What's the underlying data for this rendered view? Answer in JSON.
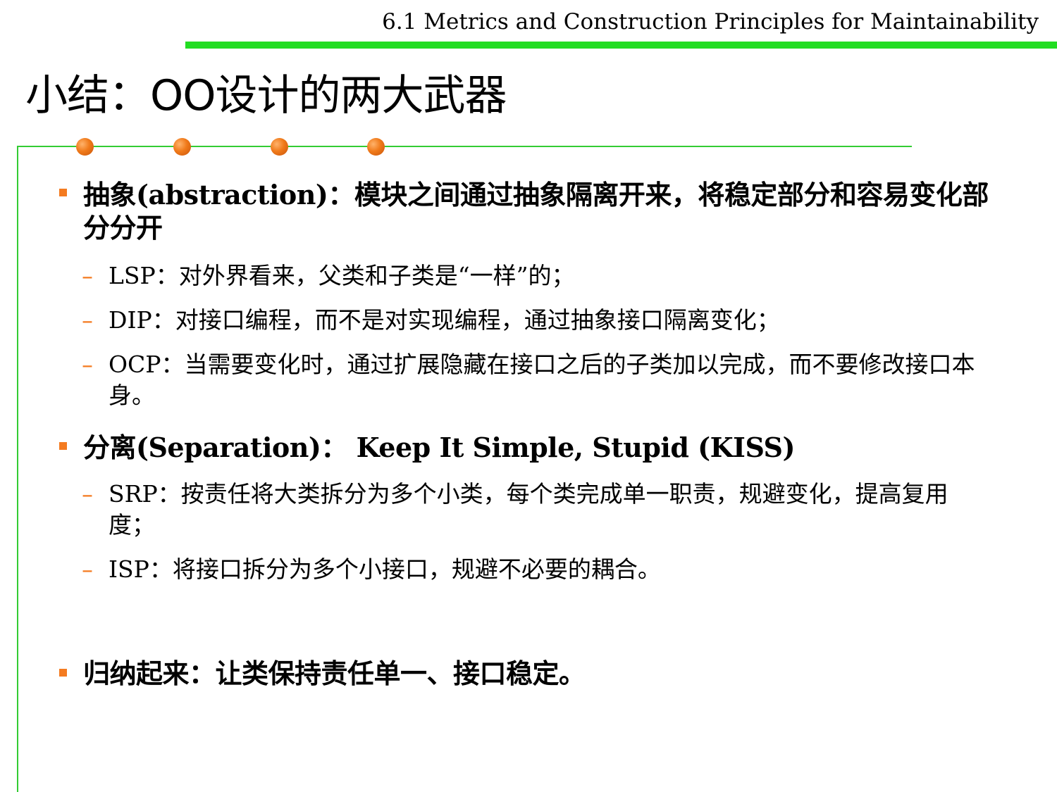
{
  "header": {
    "title": "6.1 Metrics and Construction Principles for Maintainability"
  },
  "slide": {
    "title": "小结：OO设计的两大武器"
  },
  "colors": {
    "header_rule": "#22dd22",
    "frame": "#33cc33",
    "bullet": "#f47b20",
    "dash": "#f47b20"
  },
  "points": [
    {
      "text": "抽象(abstraction)：模块之间通过抽象隔离开来，将稳定部分和容易变化部分分开",
      "subpoints": [
        "LSP：对外界看来，父类和子类是“一样”的；",
        "DIP：对接口编程，而不是对实现编程，通过抽象接口隔离变化；",
        "OCP：当需要变化时，通过扩展隐藏在接口之后的子类加以完成，而不要修改接口本身。"
      ]
    },
    {
      "text": "分离(Separation)： Keep It Simple, Stupid (KISS)",
      "subpoints": [
        "SRP：按责任将大类拆分为多个小类，每个类完成单一职责，规避变化，提高复用度；",
        "ISP：将接口拆分为多个小接口，规避不必要的耦合。"
      ]
    },
    {
      "text": "归纳起来：让类保持责任单一、接口稳定。",
      "subpoints": []
    }
  ],
  "dash_symbol": "–"
}
